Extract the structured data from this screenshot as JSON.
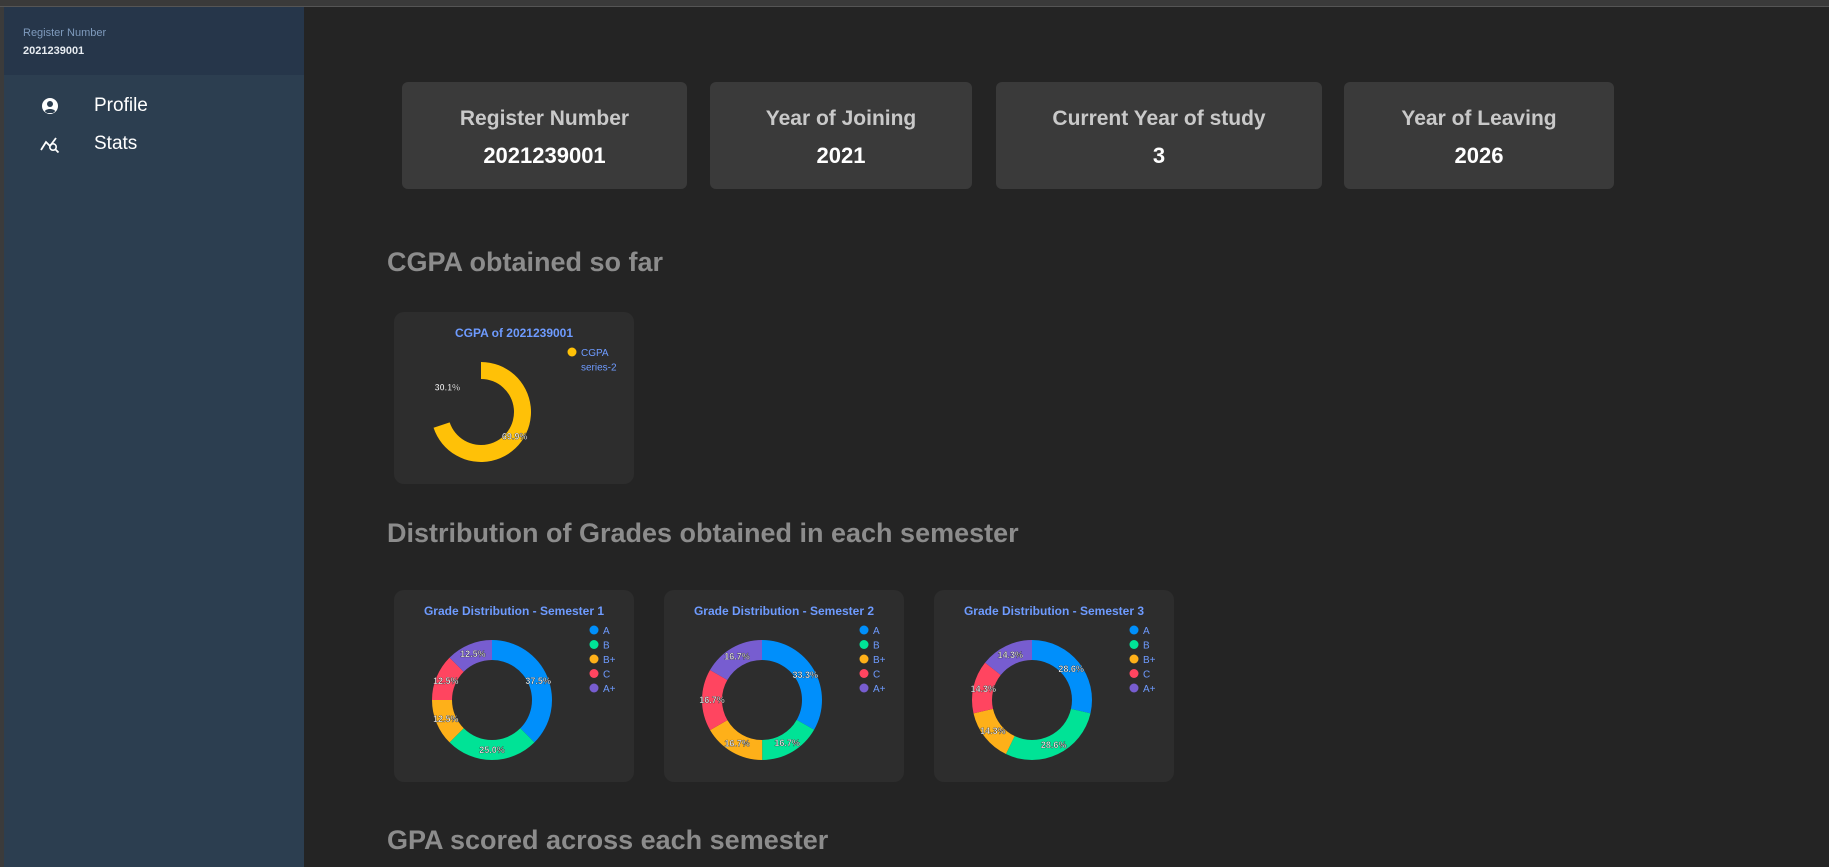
{
  "sidebar": {
    "header_label": "Register Number",
    "header_value": "2021239001",
    "items": [
      {
        "label": "Profile",
        "icon": "user-circle-icon"
      },
      {
        "label": "Stats",
        "icon": "stats-icon"
      }
    ]
  },
  "cards": [
    {
      "title": "Register Number",
      "value": "2021239001"
    },
    {
      "title": "Year of Joining",
      "value": "2021"
    },
    {
      "title": "Current Year of study",
      "value": "3"
    },
    {
      "title": "Year of Leaving",
      "value": "2026"
    }
  ],
  "sections": {
    "cgpa": "CGPA obtained so far",
    "distribution": "Distribution of Grades obtained in each semester",
    "gpa": "GPA scored across each semester"
  },
  "colors": {
    "A": "#008ffb",
    "B": "#00e396",
    "B+": "#feb019",
    "C": "#ff4560",
    "A+": "#775dd0",
    "CGPA": "#ffc107",
    "title": "#6e9bff"
  },
  "chart_data": [
    {
      "type": "pie",
      "title": "CGPA of 2021239001",
      "labels": [
        "CGPA",
        "series-2"
      ],
      "values": [
        69.9,
        30.1
      ],
      "value_labels": [
        "69.9%",
        "30.1%"
      ],
      "legend": "top-right"
    },
    {
      "type": "pie",
      "title": "Grade Distribution - Semester 1",
      "labels": [
        "A",
        "B",
        "B+",
        "C",
        "A+"
      ],
      "values": [
        37.5,
        25.0,
        12.5,
        12.5,
        12.5
      ],
      "value_labels": [
        "37.5%",
        "25.0%",
        "12.5%",
        "12.5%",
        "12.5%"
      ],
      "legend": "top-right"
    },
    {
      "type": "pie",
      "title": "Grade Distribution - Semester 2",
      "labels": [
        "A",
        "B",
        "B+",
        "C",
        "A+"
      ],
      "values": [
        33.3,
        16.7,
        16.7,
        16.7,
        16.7
      ],
      "value_labels": [
        "33.3%",
        "16.7%",
        "16.7%",
        "16.7%",
        "16.7%"
      ],
      "legend": "top-right"
    },
    {
      "type": "pie",
      "title": "Grade Distribution - Semester 3",
      "labels": [
        "A",
        "B",
        "B+",
        "C",
        "A+"
      ],
      "values": [
        28.6,
        28.6,
        14.3,
        14.3,
        14.3
      ],
      "value_labels": [
        "28.6%",
        "28.6%",
        "14.3%",
        "14.3%",
        "14.3%"
      ],
      "legend": "top-right"
    }
  ]
}
